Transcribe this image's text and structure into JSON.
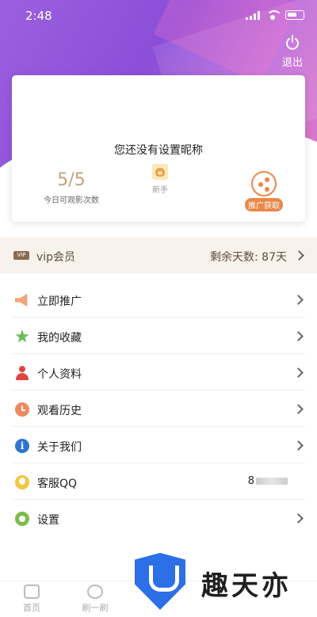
{
  "status_bar": {
    "time": "2:48"
  },
  "header": {
    "logout_label": "退出"
  },
  "profile_card": {
    "nickname_text": "您还没有设置昵称",
    "quota_value": "5/5",
    "quota_label": "今日可观影次数",
    "level_label": "新手",
    "promote_label": "推广获取"
  },
  "vip": {
    "badge": "VIP",
    "label": "vip会员",
    "remaining": "剩余天数: 87天"
  },
  "menu": {
    "items": [
      {
        "label": "立即推广",
        "icon": "megaphone-icon"
      },
      {
        "label": "我的收藏",
        "icon": "star-icon"
      },
      {
        "label": "个人资料",
        "icon": "person-icon"
      },
      {
        "label": "观看历史",
        "icon": "clock-icon"
      },
      {
        "label": "关于我们",
        "icon": "info-icon"
      },
      {
        "label": "客服QQ",
        "icon": "qq-icon",
        "value": "8"
      },
      {
        "label": "设置",
        "icon": "gear-icon"
      }
    ]
  },
  "tabbar": {
    "tabs": [
      {
        "label": "首页"
      },
      {
        "label": "刷一刷"
      }
    ]
  },
  "watermark": {
    "text": "趣天亦"
  },
  "colors": {
    "header_purple": "#9b5fe0",
    "accent_orange": "#e8884a",
    "vip_brown": "#5d4c40"
  }
}
